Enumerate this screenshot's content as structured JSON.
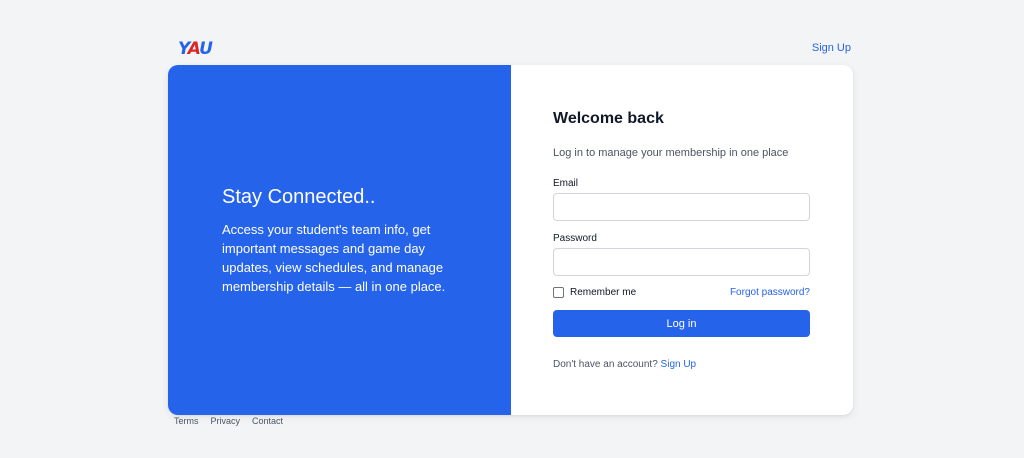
{
  "header": {
    "logo_text": "YAU",
    "signup_label": "Sign Up"
  },
  "hero": {
    "title": "Stay Connected..",
    "body": "Access your student's team info, get important messages and game day updates, view schedules, and manage membership details — all in one place."
  },
  "login": {
    "title": "Welcome back",
    "subtitle": "Log in to manage your membership in one place",
    "email_label": "Email",
    "email_value": "",
    "password_label": "Password",
    "password_value": "",
    "remember_label": "Remember me",
    "forgot_label": "Forgot password?",
    "submit_label": "Log in",
    "no_account_text": "Don't have an account?",
    "signup_link": "Sign Up"
  },
  "footer": {
    "links": [
      "Terms",
      "Privacy",
      "Contact"
    ]
  },
  "colors": {
    "accent": "#2563eb",
    "background": "#f3f4f6",
    "logo_red": "#dc2626"
  }
}
